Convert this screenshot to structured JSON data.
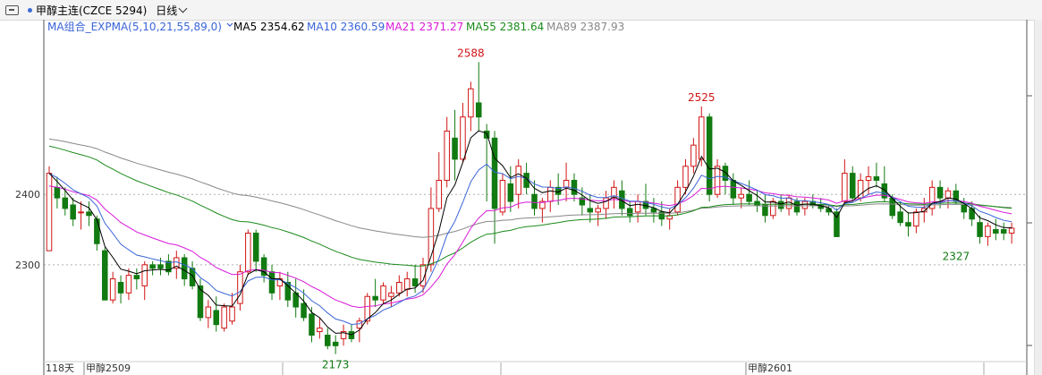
{
  "header": {
    "title": "甲醇主连(CZCE 5294)",
    "period": "日线"
  },
  "footer": {
    "day_count": "118天",
    "contract_labels": [
      "甲醇2509",
      "甲醇2601"
    ]
  },
  "colors": {
    "up": "#d11515",
    "down": "#117a11",
    "MA5": "#000000",
    "MA10": "#3a64d8",
    "MA21": "#d81ad8",
    "MA55": "#1a8a1a",
    "MA89": "#888888",
    "legend_prefix": "#3a64d8"
  },
  "chart_data": {
    "type": "candlestick",
    "yticks": [
      2300,
      2400
    ],
    "ylim": [
      2165,
      2605
    ],
    "indicator_legend": {
      "prefix": "MA组合_EXPMA(5,10,21,55,89,0)",
      "items": [
        {
          "name": "MA5",
          "text": "MA5 2354.62"
        },
        {
          "name": "MA10",
          "text": "MA10 2360.59"
        },
        {
          "name": "MA21",
          "text": "MA21 2371.27"
        },
        {
          "name": "MA55",
          "text": "MA55 2381.64"
        },
        {
          "name": "MA89",
          "text": "MA89 2387.93"
        }
      ]
    },
    "annotations": [
      {
        "text": "2588",
        "index": 53,
        "value": 2588,
        "pos": "above",
        "color": "#d11515"
      },
      {
        "text": "2525",
        "index": 82,
        "value": 2525,
        "pos": "above",
        "color": "#d11515"
      },
      {
        "text": "2173",
        "index": 36,
        "value": 2173,
        "pos": "below",
        "color": "#117a11"
      },
      {
        "text": "2327",
        "index": 114,
        "value": 2327,
        "pos": "below",
        "color": "#117a11"
      }
    ],
    "ohlc": [
      [
        2320,
        2440,
        2320,
        2430
      ],
      [
        2410,
        2425,
        2380,
        2395
      ],
      [
        2395,
        2410,
        2370,
        2380
      ],
      [
        2385,
        2395,
        2355,
        2365
      ],
      [
        2375,
        2390,
        2350,
        2375
      ],
      [
        2375,
        2390,
        2355,
        2370
      ],
      [
        2365,
        2370,
        2320,
        2330
      ],
      [
        2320,
        2325,
        2250,
        2250
      ],
      [
        2250,
        2290,
        2245,
        2280
      ],
      [
        2275,
        2285,
        2245,
        2260
      ],
      [
        2260,
        2295,
        2250,
        2285
      ],
      [
        2285,
        2295,
        2265,
        2280
      ],
      [
        2270,
        2305,
        2250,
        2300
      ],
      [
        2300,
        2305,
        2285,
        2295
      ],
      [
        2300,
        2310,
        2285,
        2295
      ],
      [
        2305,
        2315,
        2285,
        2290
      ],
      [
        2295,
        2320,
        2280,
        2310
      ],
      [
        2310,
        2315,
        2270,
        2280
      ],
      [
        2295,
        2305,
        2265,
        2270
      ],
      [
        2270,
        2280,
        2220,
        2225
      ],
      [
        2225,
        2250,
        2210,
        2240
      ],
      [
        2235,
        2255,
        2205,
        2215
      ],
      [
        2210,
        2245,
        2205,
        2240
      ],
      [
        2220,
        2260,
        2215,
        2240
      ],
      [
        2245,
        2300,
        2235,
        2290
      ],
      [
        2290,
        2350,
        2285,
        2345
      ],
      [
        2345,
        2350,
        2290,
        2305
      ],
      [
        2310,
        2315,
        2275,
        2285
      ],
      [
        2290,
        2300,
        2250,
        2260
      ],
      [
        2270,
        2290,
        2250,
        2280
      ],
      [
        2275,
        2290,
        2240,
        2250
      ],
      [
        2260,
        2280,
        2225,
        2240
      ],
      [
        2245,
        2265,
        2220,
        2225
      ],
      [
        2230,
        2240,
        2190,
        2200
      ],
      [
        2205,
        2225,
        2195,
        2210
      ],
      [
        2200,
        2210,
        2180,
        2185
      ],
      [
        2190,
        2200,
        2173,
        2185
      ],
      [
        2195,
        2215,
        2185,
        2205
      ],
      [
        2205,
        2215,
        2190,
        2195
      ],
      [
        2210,
        2225,
        2190,
        2220
      ],
      [
        2220,
        2260,
        2215,
        2255
      ],
      [
        2255,
        2280,
        2240,
        2250
      ],
      [
        2250,
        2275,
        2245,
        2270
      ],
      [
        2255,
        2270,
        2240,
        2260
      ],
      [
        2260,
        2285,
        2255,
        2275
      ],
      [
        2265,
        2290,
        2255,
        2280
      ],
      [
        2280,
        2300,
        2260,
        2270
      ],
      [
        2270,
        2310,
        2260,
        2300
      ],
      [
        2300,
        2410,
        2290,
        2380
      ],
      [
        2380,
        2460,
        2375,
        2420
      ],
      [
        2420,
        2510,
        2410,
        2490
      ],
      [
        2480,
        2520,
        2420,
        2450
      ],
      [
        2450,
        2530,
        2445,
        2510
      ],
      [
        2510,
        2560,
        2490,
        2550
      ],
      [
        2530,
        2588,
        2490,
        2510
      ],
      [
        2490,
        2500,
        2390,
        2480
      ],
      [
        2480,
        2490,
        2330,
        2380
      ],
      [
        2375,
        2430,
        2370,
        2420
      ],
      [
        2415,
        2440,
        2375,
        2390
      ],
      [
        2400,
        2450,
        2380,
        2440
      ],
      [
        2430,
        2445,
        2400,
        2410
      ],
      [
        2400,
        2420,
        2370,
        2380
      ],
      [
        2380,
        2395,
        2360,
        2390
      ],
      [
        2390,
        2420,
        2375,
        2410
      ],
      [
        2410,
        2430,
        2385,
        2400
      ],
      [
        2410,
        2445,
        2390,
        2420
      ],
      [
        2420,
        2430,
        2390,
        2400
      ],
      [
        2395,
        2410,
        2370,
        2385
      ],
      [
        2380,
        2400,
        2360,
        2375
      ],
      [
        2375,
        2385,
        2355,
        2380
      ],
      [
        2380,
        2405,
        2365,
        2395
      ],
      [
        2395,
        2420,
        2380,
        2410
      ],
      [
        2405,
        2420,
        2370,
        2380
      ],
      [
        2380,
        2390,
        2360,
        2370
      ],
      [
        2375,
        2400,
        2360,
        2390
      ],
      [
        2390,
        2415,
        2370,
        2380
      ],
      [
        2380,
        2395,
        2360,
        2375
      ],
      [
        2375,
        2390,
        2355,
        2365
      ],
      [
        2365,
        2380,
        2350,
        2370
      ],
      [
        2375,
        2420,
        2370,
        2410
      ],
      [
        2410,
        2450,
        2400,
        2440
      ],
      [
        2440,
        2480,
        2430,
        2470
      ],
      [
        2450,
        2525,
        2440,
        2510
      ],
      [
        2510,
        2515,
        2390,
        2400
      ],
      [
        2400,
        2450,
        2395,
        2440
      ],
      [
        2440,
        2445,
        2400,
        2420
      ],
      [
        2420,
        2430,
        2385,
        2395
      ],
      [
        2395,
        2410,
        2380,
        2400
      ],
      [
        2400,
        2420,
        2385,
        2390
      ],
      [
        2390,
        2405,
        2375,
        2385
      ],
      [
        2385,
        2400,
        2360,
        2370
      ],
      [
        2370,
        2395,
        2365,
        2390
      ],
      [
        2390,
        2400,
        2375,
        2380
      ],
      [
        2380,
        2400,
        2370,
        2395
      ],
      [
        2390,
        2395,
        2370,
        2375
      ],
      [
        2380,
        2395,
        2370,
        2390
      ],
      [
        2390,
        2400,
        2380,
        2385
      ],
      [
        2385,
        2395,
        2375,
        2380
      ],
      [
        2380,
        2385,
        2370,
        2375
      ],
      [
        2375,
        2380,
        2340,
        2340
      ],
      [
        2390,
        2450,
        2385,
        2430
      ],
      [
        2430,
        2440,
        2390,
        2395
      ],
      [
        2395,
        2430,
        2390,
        2420
      ],
      [
        2420,
        2440,
        2400,
        2425
      ],
      [
        2425,
        2445,
        2410,
        2420
      ],
      [
        2415,
        2440,
        2390,
        2395
      ],
      [
        2395,
        2400,
        2365,
        2370
      ],
      [
        2375,
        2390,
        2355,
        2360
      ],
      [
        2360,
        2375,
        2340,
        2355
      ],
      [
        2355,
        2380,
        2345,
        2375
      ],
      [
        2375,
        2395,
        2360,
        2380
      ],
      [
        2380,
        2420,
        2370,
        2410
      ],
      [
        2410,
        2420,
        2380,
        2395
      ],
      [
        2395,
        2410,
        2380,
        2405
      ],
      [
        2405,
        2415,
        2385,
        2390
      ],
      [
        2385,
        2395,
        2365,
        2375
      ],
      [
        2380,
        2390,
        2355,
        2365
      ],
      [
        2360,
        2370,
        2330,
        2340
      ],
      [
        2340,
        2360,
        2327,
        2355
      ],
      [
        2350,
        2365,
        2335,
        2345
      ],
      [
        2350,
        2360,
        2335,
        2345
      ],
      [
        2345,
        2360,
        2330,
        2352
      ]
    ]
  }
}
